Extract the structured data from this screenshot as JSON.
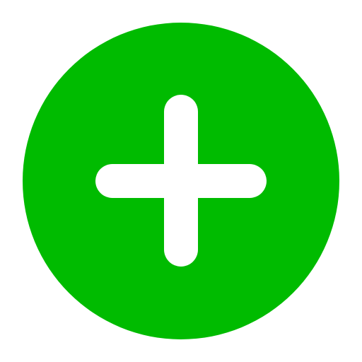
{
  "icon": {
    "name": "add-circle-icon",
    "circle_color": "#00BB00",
    "plus_color": "#FFFFFF"
  }
}
